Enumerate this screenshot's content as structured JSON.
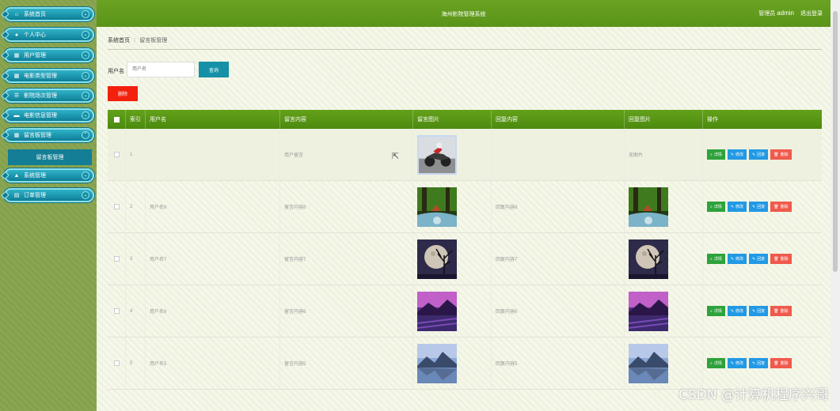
{
  "sidebar": {
    "items": [
      {
        "label": "系统首页",
        "icon": "home-icon",
        "glyph": "⌂"
      },
      {
        "label": "个人中心",
        "icon": "user-icon",
        "glyph": "●"
      },
      {
        "label": "用户管理",
        "icon": "grid-icon",
        "glyph": "▦"
      },
      {
        "label": "电影类型管理",
        "icon": "grid-icon",
        "glyph": "▦"
      },
      {
        "label": "影院场次管理",
        "icon": "sliders-icon",
        "glyph": "☰"
      },
      {
        "label": "电影信息管理",
        "icon": "film-icon",
        "glyph": "▬"
      },
      {
        "label": "留言板管理",
        "icon": "grid-icon",
        "glyph": "▦"
      },
      {
        "label": "系统管理",
        "icon": "house-icon",
        "glyph": "▲"
      },
      {
        "label": "订单管理",
        "icon": "clipboard-icon",
        "glyph": "▤"
      }
    ],
    "submenu": {
      "label": "留言板管理"
    }
  },
  "header": {
    "title": "海州影院管理系统",
    "role": "管理员",
    "username": "admin",
    "logout": "退出登录"
  },
  "breadcrumb": {
    "home": "系统首页",
    "current": "留言板管理"
  },
  "search": {
    "label": "用户名",
    "placeholder": "用户名",
    "button": "查询"
  },
  "actions": {
    "delete": "删除"
  },
  "table": {
    "headers": [
      "索引",
      "用户名",
      "留言内容",
      "留言图片",
      "回复内容",
      "回复图片",
      "操作"
    ],
    "buttons": {
      "detail": "详情",
      "edit": "修改",
      "reply": "回复",
      "delete": "删除"
    },
    "rows": [
      {
        "index": "1",
        "username": "",
        "content": "用户留言",
        "image": "motorcycle",
        "reply": "",
        "reply_image": "无图片"
      },
      {
        "index": "2",
        "username": "用户名8",
        "content": "留言内容8",
        "image": "forest",
        "reply": "回复内容8",
        "reply_image": "forest"
      },
      {
        "index": "3",
        "username": "用户名7",
        "content": "留言内容7",
        "image": "moon",
        "reply": "回复内容7",
        "reply_image": "moon"
      },
      {
        "index": "4",
        "username": "用户名6",
        "content": "留言内容6",
        "image": "purple",
        "reply": "回复内容6",
        "reply_image": "purple"
      },
      {
        "index": "5",
        "username": "用户名5",
        "content": "留言内容5",
        "image": "mountain",
        "reply": "回复内容5",
        "reply_image": "mountain"
      }
    ]
  },
  "watermark": "CSDN @计算机程序兴哥"
}
